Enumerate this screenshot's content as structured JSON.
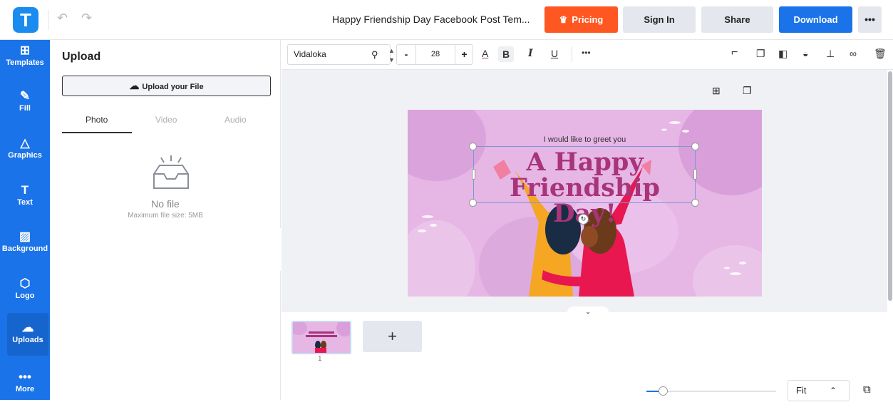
{
  "header": {
    "logo_letter": "T",
    "undo_icon": "↶",
    "redo_icon": "↷",
    "doc_title": "Happy Friendship Day Facebook Post Tem...",
    "pricing_label": "Pricing",
    "signin_label": "Sign In",
    "share_label": "Share",
    "download_label": "Download",
    "more_label": "•••",
    "colors": {
      "pricing": "#ff5722",
      "download": "#1a73e8",
      "secondary": "#e4e7ee"
    }
  },
  "sidebar": {
    "color": "#1a73e8",
    "items": [
      {
        "label": "Templates",
        "icon": "templates-icon",
        "glyph": "⊞"
      },
      {
        "label": "Fill",
        "icon": "brush-icon",
        "glyph": "✎"
      },
      {
        "label": "Graphics",
        "icon": "shapes-icon",
        "glyph": "△"
      },
      {
        "label": "Text",
        "icon": "text-icon",
        "glyph": "T"
      },
      {
        "label": "Background",
        "icon": "background-icon",
        "glyph": "▨"
      },
      {
        "label": "Logo",
        "icon": "logo-icon",
        "glyph": "⬡"
      },
      {
        "label": "Uploads",
        "icon": "cloud-upload-icon",
        "glyph": "☁"
      },
      {
        "label": "More",
        "icon": "more-icon",
        "glyph": "•••"
      }
    ],
    "active": "Uploads"
  },
  "panel": {
    "title": "Upload",
    "upload_button": "Upload your File",
    "tabs": [
      "Photo",
      "Video",
      "Audio"
    ],
    "active_tab": "Photo",
    "empty_text": "No file",
    "max_size": "Maximum file size: 5MB"
  },
  "toolbar": {
    "font": "Vidaloka",
    "font_size": "28",
    "minus": "-",
    "plus": "+",
    "color_a": "A",
    "bold": "B",
    "italic": "I",
    "underline": "U",
    "more": "•••",
    "right_icons": [
      "format-painter-icon",
      "duplicate-icon",
      "layer-icon",
      "opacity-icon",
      "align-icon",
      "link-icon",
      "trash-icon"
    ]
  },
  "canvas": {
    "greeting": "I would like to greet you",
    "headline": "A Happy Friendship Day!",
    "colors": {
      "background": "#e6b6e5",
      "headline": "#a8347a"
    }
  },
  "pages": {
    "page_number": "1",
    "add_label": "+"
  },
  "zoom": {
    "fit_label": "Fit",
    "level_fraction": 0.12
  }
}
